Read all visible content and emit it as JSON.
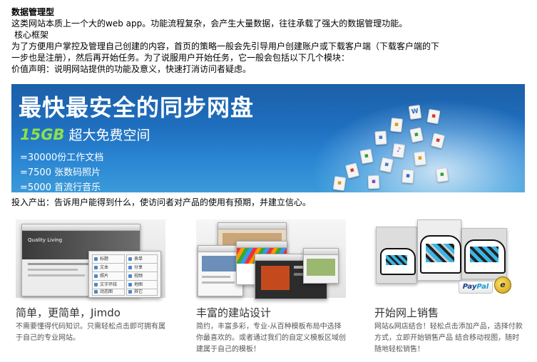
{
  "article": {
    "heading": "数据管理型",
    "intro": "这类网站本质上一个大的web app。功能流程复杂，会产生大量数据，往往承载了强大的数据管理功能。",
    "subheading": "核心框架",
    "body_line1": "为了方便用户掌控及管理自己创建的内容，首页的策略一般会先引导用户创建账户或下载客户端（下载客户端的下",
    "body_line2": "一步也是注册），然后再开始任务。为了说服用户开始任务，它一般会包括以下几个模块：",
    "value_statement": "价值声明：说明网站提供的功能及意义，快速打消访问者疑虑。",
    "io_statement": "投入产出：告诉用户能得到什么，使访问者对产品的使用有预期，并建立信心。"
  },
  "banner": {
    "title": "最快最安全的同步网盘",
    "storage_amount": "15GB",
    "storage_label": "超大免费空间",
    "lines": [
      "=30000份工作文档",
      "=7500 张数码照片",
      "=5000 首流行音乐"
    ],
    "colors": {
      "sky": "#1f6fbf",
      "accent_green": "#8fe04a"
    }
  },
  "features": [
    {
      "title": "简单，更简单，Jimdo",
      "desc": "不需要懂得代码知识。只需轻松点击即可拥有属于自己的专业网站。",
      "mock": {
        "site_name": "Quality Living",
        "menu_left": [
          "标题",
          "文本",
          "照片",
          "文字环绕",
          "动态图"
        ],
        "menu_right": [
          "表单",
          "分享",
          "视频",
          "地图",
          "其它"
        ]
      }
    },
    {
      "title": "丰富的建站设计",
      "desc": "简约，丰富多彩，专业-从百种模板布局中选择你最喜欢的。或者通过我们的自定义模板区域创建属于自己的模板！"
    },
    {
      "title": "开始网上销售",
      "desc": "网站&网店结合！轻松点击添加产品，选择付款方式，立即开始销售产品 结合移动视图，随时随地轻松销售！",
      "mock": {
        "payment_brand_a": "Pay",
        "payment_brand_b": "Pal",
        "seal_letter": "e"
      }
    }
  ]
}
